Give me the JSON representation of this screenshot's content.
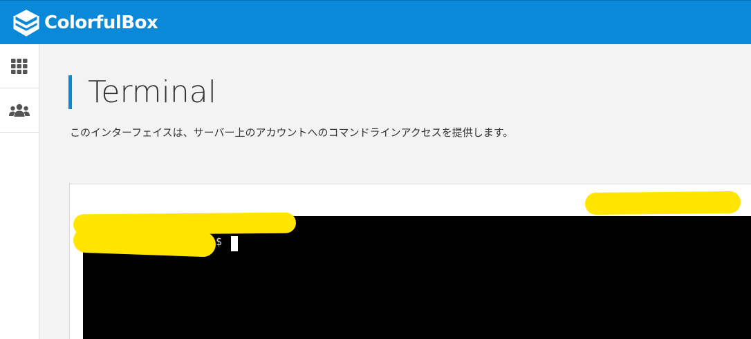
{
  "header": {
    "brand_name": "ColorfulBox",
    "accent_color": "#0a89d8",
    "logo_icon": "stacked-layers-logo-icon"
  },
  "sidebar": {
    "items": [
      {
        "icon": "grid-icon",
        "label": ""
      },
      {
        "icon": "users-icon",
        "label": ""
      }
    ]
  },
  "page": {
    "title": "Terminal",
    "description": "このインターフェイスは、サーバー上のアカウントへのコマンドラインアクセスを提供します。"
  },
  "terminal": {
    "prompt_symbol": "$",
    "background_color": "#000000"
  }
}
